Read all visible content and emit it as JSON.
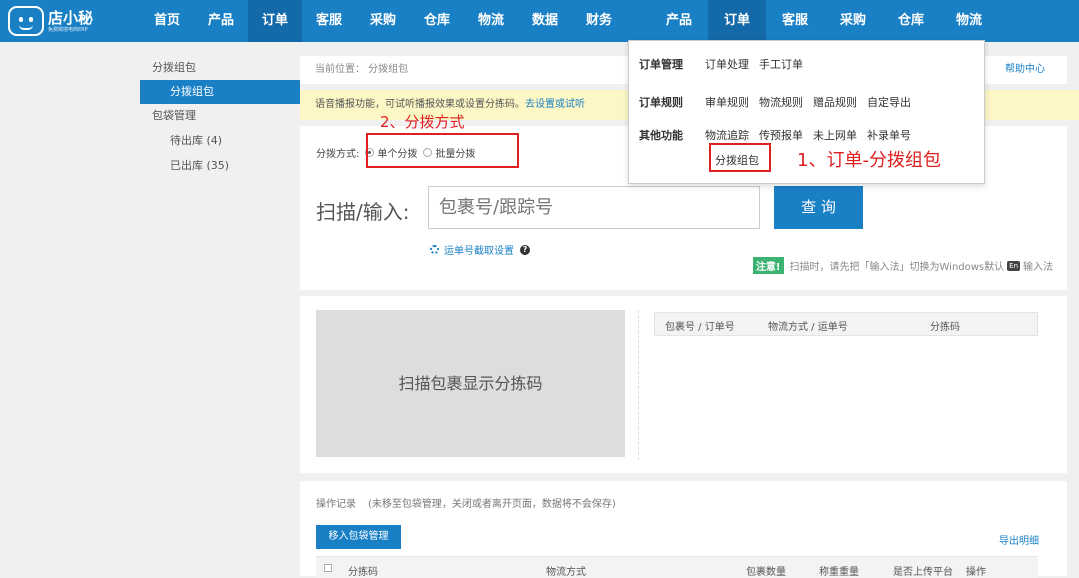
{
  "logo": {
    "name": "店小秘",
    "sub": "免费跨境电商ERP"
  },
  "nav_main": [
    "首页",
    "产品",
    "订单",
    "客服",
    "采购",
    "仓库",
    "物流",
    "数据",
    "财务"
  ],
  "nav_main_active": 2,
  "nav_dup": [
    "产品",
    "订单",
    "客服",
    "采购",
    "仓库",
    "物流"
  ],
  "nav_dup_active": 1,
  "sidebar": {
    "group1": "分拨组包",
    "selected": "分拨组包",
    "group2": "包袋管理",
    "items": [
      "待出库 (4)",
      "已出库 (35)"
    ]
  },
  "breadcrumb": "当前位置： 分拨组包",
  "help": "帮助中心",
  "notice": {
    "text": "语音播报功能，可试听播报效果或设置分拣码。",
    "link": "去设置或试听"
  },
  "mode": {
    "label": "分拨方式:",
    "single": "单个分拨",
    "batch": "批量分拨"
  },
  "scan": {
    "label": "扫描/输入:",
    "placeholder": "包裹号/跟踪号",
    "button": "查 询",
    "setting": "运单号截取设置"
  },
  "tip": {
    "badge": "注意!",
    "text_before": "扫描时，请先把「输入法」切换为Windows默认",
    "en_icon": "En",
    "text_after": "输入法"
  },
  "pack_box": "扫描包裹显示分拣码",
  "table": {
    "headers": [
      "包裹号 / 订单号",
      "物流方式 / 运单号",
      "分拣码"
    ]
  },
  "log": {
    "title": "操作记录",
    "note": "(未移至包袋管理，关闭或者离开页面，数据将不会保存)",
    "move_button": "移入包袋管理",
    "export": "导出明细",
    "headers": [
      "分拣码",
      "物流方式",
      "包裹数量",
      "称重重量",
      "是否上传平台",
      "操作"
    ]
  },
  "dropdown": {
    "rows": [
      {
        "cat": "订单管理",
        "links": [
          "订单处理",
          "手工订单"
        ]
      },
      {
        "cat": "订单规则",
        "links": [
          "审单规则",
          "物流规则",
          "赠品规则",
          "自定导出"
        ]
      },
      {
        "cat": "其他功能",
        "links": [
          "物流追踪",
          "传预报单",
          "未上网单",
          "补录单号"
        ]
      }
    ],
    "extra": "分拨组包"
  },
  "annotations": {
    "a1": "2、分拨方式",
    "a2": "1、订单-分拨组包"
  },
  "colors": {
    "primary": "#1a80c6",
    "annotation": "#e02020",
    "notice_bg": "#fcf7c5"
  }
}
